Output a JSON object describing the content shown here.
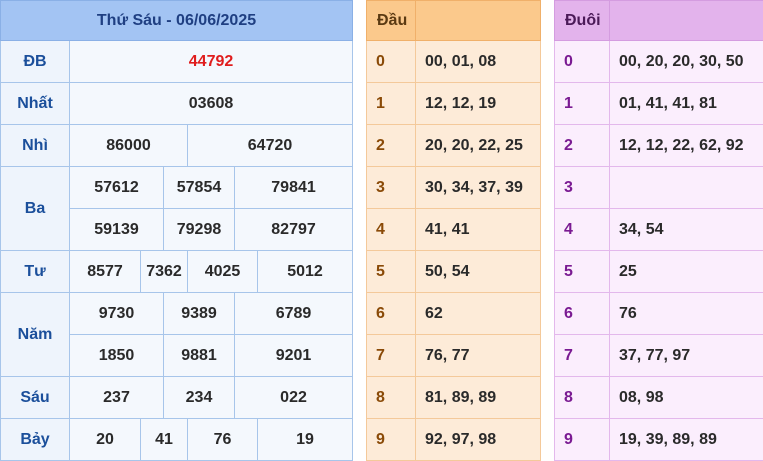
{
  "header": {
    "title": "Thứ Sáu - 06/06/2025"
  },
  "prizes": {
    "db": {
      "label": "ĐB",
      "values": [
        "44792"
      ]
    },
    "nhat": {
      "label": "Nhất",
      "values": [
        "03608"
      ]
    },
    "nhi": {
      "label": "Nhì",
      "values": [
        "86000",
        "64720"
      ]
    },
    "ba": {
      "label": "Ba",
      "values": [
        "57612",
        "57854",
        "79841",
        "59139",
        "79298",
        "82797"
      ]
    },
    "tu": {
      "label": "Tư",
      "values": [
        "8577",
        "7362",
        "4025",
        "5012"
      ]
    },
    "nam": {
      "label": "Năm",
      "values": [
        "9730",
        "9389",
        "6789",
        "1850",
        "9881",
        "9201"
      ]
    },
    "sau": {
      "label": "Sáu",
      "values": [
        "237",
        "234",
        "022"
      ]
    },
    "bay": {
      "label": "Bảy",
      "values": [
        "20",
        "41",
        "76",
        "19"
      ]
    }
  },
  "dau": {
    "header": "Đầu",
    "rows": [
      {
        "k": "0",
        "v": "00, 01, 08"
      },
      {
        "k": "1",
        "v": "12, 12, 19"
      },
      {
        "k": "2",
        "v": "20, 20, 22, 25"
      },
      {
        "k": "3",
        "v": "30, 34, 37, 39"
      },
      {
        "k": "4",
        "v": "41, 41"
      },
      {
        "k": "5",
        "v": "50, 54"
      },
      {
        "k": "6",
        "v": "62"
      },
      {
        "k": "7",
        "v": "76, 77"
      },
      {
        "k": "8",
        "v": "81, 89, 89"
      },
      {
        "k": "9",
        "v": "92, 97, 98"
      }
    ]
  },
  "duoi": {
    "header": "Đuôi",
    "rows": [
      {
        "k": "0",
        "v": "00, 20, 20, 30, 50"
      },
      {
        "k": "1",
        "v": "01, 41, 41, 81"
      },
      {
        "k": "2",
        "v": "12, 12, 22, 62, 92"
      },
      {
        "k": "3",
        "v": ""
      },
      {
        "k": "4",
        "v": "34, 54"
      },
      {
        "k": "5",
        "v": "25"
      },
      {
        "k": "6",
        "v": "76"
      },
      {
        "k": "7",
        "v": "37, 77, 97"
      },
      {
        "k": "8",
        "v": "08, 98"
      },
      {
        "k": "9",
        "v": "19, 39, 89, 89"
      }
    ]
  }
}
